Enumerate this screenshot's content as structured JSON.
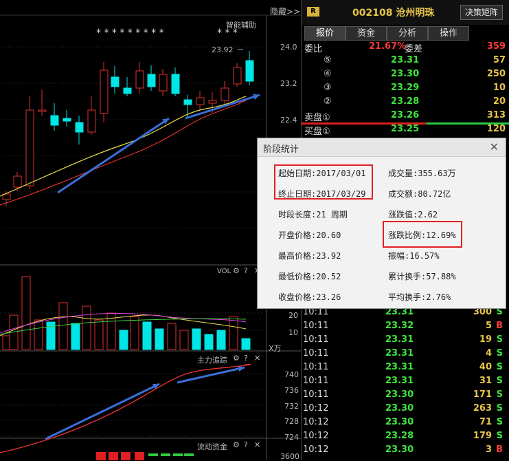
{
  "chart": {
    "hide_label": "隐藏>>",
    "assist_label": "智能辅助",
    "stars_left": "* * * * * * * * *",
    "stars_right": "* * *",
    "high_marker": "23.92",
    "price_axis": [
      "24.0",
      "23.2",
      "22.4"
    ],
    "vol_label": "VOL",
    "vol_axis": [
      "20",
      "10"
    ],
    "vol_unit": "X万",
    "main_track_label": "主力追踪",
    "track_axis": [
      "740",
      "736",
      "732",
      "728",
      "724"
    ],
    "flow_label": "流动资金",
    "flow_axis": [
      "3600"
    ],
    "colors": {
      "up": "#e03030",
      "down": "#00e5e5",
      "ma_yellow": "#e8e050",
      "ma_red": "#e03030",
      "arrow": "#3a6fd8"
    }
  },
  "header": {
    "badge": "R",
    "stock_code": "002108",
    "stock_name": "沧州明珠",
    "matrix_button": "决策矩阵"
  },
  "tabs": [
    "报价",
    "资金",
    "分析",
    "操作"
  ],
  "order_book": {
    "weibi_label": "委比",
    "weibi_value": "21.67%",
    "weicha_label": "委差",
    "weicha_value": "359",
    "asks": [
      {
        "level": "⑤",
        "price": "23.31",
        "vol": "57"
      },
      {
        "level": "④",
        "price": "23.30",
        "vol": "250"
      },
      {
        "level": "③",
        "price": "23.29",
        "vol": "10"
      },
      {
        "level": "②",
        "price": "23.28",
        "vol": "20"
      },
      {
        "level": "卖盘①",
        "price": "23.26",
        "vol": "313"
      }
    ],
    "bids": [
      {
        "level": "买盘①",
        "price": "23.25",
        "vol": "120"
      }
    ]
  },
  "ticks": [
    {
      "time": "10:11",
      "price": "23.31",
      "vol": "300",
      "side": "S"
    },
    {
      "time": "10:11",
      "price": "23.32",
      "vol": "5",
      "side": "B"
    },
    {
      "time": "10:11",
      "price": "23.31",
      "vol": "19",
      "side": "S"
    },
    {
      "time": "10:11",
      "price": "23.31",
      "vol": "4",
      "side": "S"
    },
    {
      "time": "10:11",
      "price": "23.31",
      "vol": "40",
      "side": "S"
    },
    {
      "time": "10:11",
      "price": "23.31",
      "vol": "31",
      "side": "S"
    },
    {
      "time": "10:11",
      "price": "23.30",
      "vol": "171",
      "side": "S"
    },
    {
      "time": "10:12",
      "price": "23.30",
      "vol": "263",
      "side": "S"
    },
    {
      "time": "10:12",
      "price": "23.30",
      "vol": "71",
      "side": "S"
    },
    {
      "time": "10:12",
      "price": "23.28",
      "vol": "179",
      "side": "S"
    },
    {
      "time": "10:12",
      "price": "23.30",
      "vol": "3",
      "side": "B"
    }
  ],
  "dialog": {
    "title": "阶段统计",
    "close": "✕",
    "start_date": "起始日期:2017/03/01",
    "end_date": "终止日期:2017/03/29",
    "period": "时段长度:21 周期",
    "open": "开盘价格:20.60",
    "high": "最高价格:23.92",
    "low": "最低价格:20.52",
    "close_price": "收盘价格:23.26",
    "volume": "成交量:355.63万",
    "amount": "成交额:80.72亿",
    "change": "涨跌值:2.62",
    "change_pct": "涨跌比例:12.69%",
    "amplitude": "振幅:16.57%",
    "turnover_total": "累计换手:57.88%",
    "turnover_avg": "平均换手:2.76%"
  }
}
